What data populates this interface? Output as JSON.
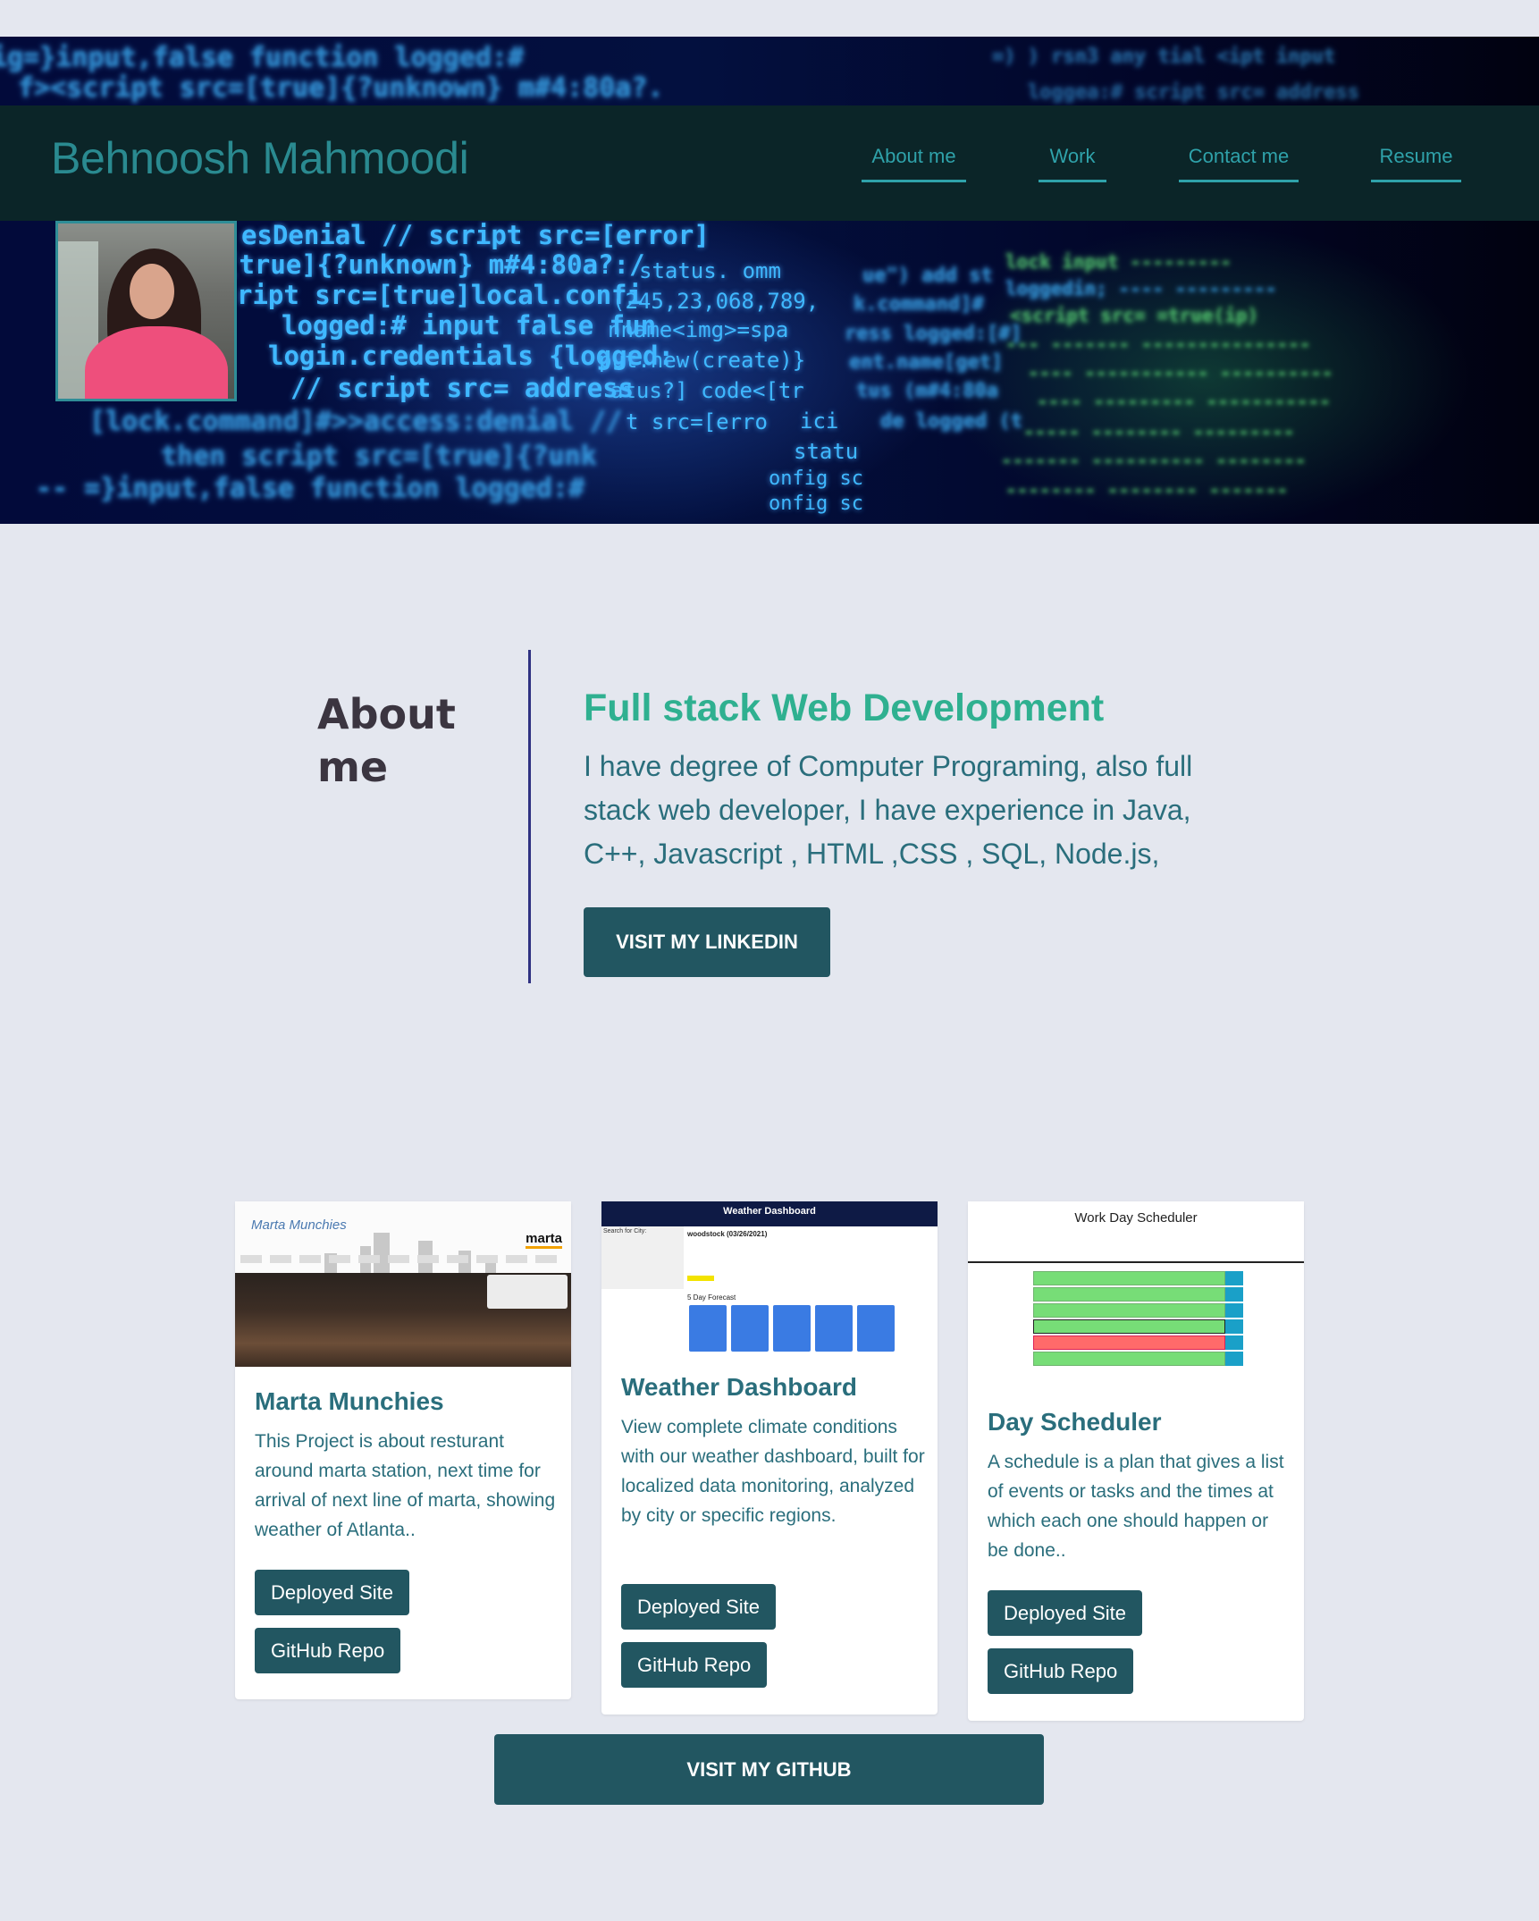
{
  "header": {
    "brand": "Behnoosh Mahmoodi",
    "nav": [
      {
        "label": "About me"
      },
      {
        "label": "Work"
      },
      {
        "label": "Contact me"
      },
      {
        "label": "Resume"
      }
    ]
  },
  "about": {
    "title": "About me",
    "heading": "Full stack Web Development",
    "text": "I have degree of Computer Programing, also full stack web developer, I have experience in Java, C++, Javascript , HTML ,CSS , SQL, Node.js,",
    "button": "VISIT MY LINKEDIN"
  },
  "projects": [
    {
      "title": "Marta Munchies",
      "description": "This Project is about resturant around marta station, next time for arrival of next line of marta, showing weather of Atlanta..",
      "deployed_label": "Deployed Site",
      "repo_label": "GitHub Repo",
      "thumb": {
        "brand": "Marta Munchies",
        "logo": "marta"
      }
    },
    {
      "title": "Weather Dashboard",
      "description": "View complete climate conditions with our weather dashboard, built for localized data monitoring, analyzed by city or specific regions.",
      "deployed_label": "Deployed Site",
      "repo_label": "GitHub Repo",
      "thumb": {
        "bar_title": "Weather Dashboard",
        "city_label": "woodstock (03/26/2021)",
        "forecast_label": "5 Day Forecast",
        "search_label": "Search for City:"
      }
    },
    {
      "title": "Day Scheduler",
      "description": "A schedule is a plan that gives a list of events or tasks and the times at which each one should happen or be done..",
      "deployed_label": "Deployed Site",
      "repo_label": "GitHub Repo",
      "thumb": {
        "title": "Work Day Scheduler"
      }
    }
  ],
  "github_button": "VISIT MY GITHUB",
  "colors": {
    "page_bg": "#e4e7ef",
    "navbar_bg": "#0b2528",
    "brand": "#2a8a90",
    "accent_green": "#2fb090",
    "button_bg": "#225661",
    "divider": "#2f3182"
  }
}
